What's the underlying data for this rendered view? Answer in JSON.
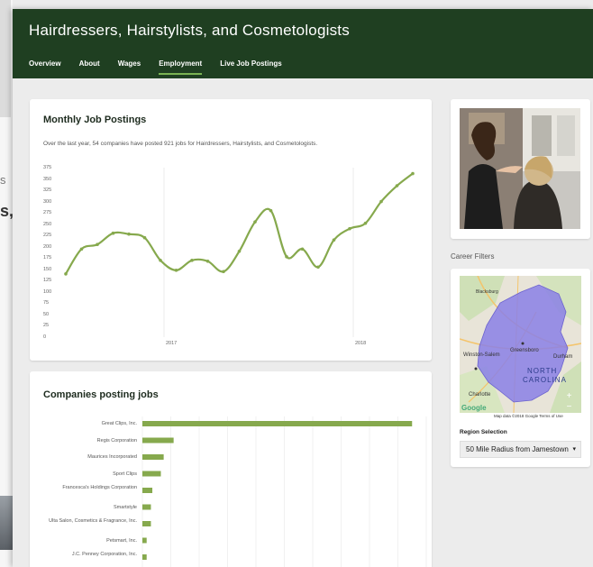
{
  "background": {
    "frag_a": "s",
    "frag_b": "s,"
  },
  "header": {
    "title": "Hairdressers, Hairstylists, and Cosmetologists",
    "tabs": [
      {
        "label": "Overview"
      },
      {
        "label": "About"
      },
      {
        "label": "Wages"
      },
      {
        "label": "Employment",
        "active": true
      },
      {
        "label": "Live Job Postings"
      }
    ]
  },
  "job_postings": {
    "title": "Monthly Job Postings",
    "subtitle": "Over the last year, 54 companies have posted 921 jobs for Hairdressers, Hairstylists, and Cosmetologists."
  },
  "companies": {
    "title": "Companies posting jobs"
  },
  "sidebar": {
    "career_filters_label": "Career Filters",
    "region_label": "Region Selection",
    "region_value": "50 Mile Radius from Jamestown",
    "map": {
      "city_1": "Blacksburg",
      "city_2": "Winston-Salem",
      "city_3": "Greensboro",
      "city_4": "Durham",
      "city_5": "Charlotte",
      "state_1": "NORTH",
      "state_2": "CAROLINA",
      "google": "Google",
      "footer": "Map data ©2018 Google   Terms of Use",
      "zoom_in": "+",
      "zoom_out": "−"
    }
  },
  "chart_data": [
    {
      "type": "line",
      "title": "Monthly Job Postings",
      "yticks": [
        "375",
        "350",
        "325",
        "300",
        "275",
        "250",
        "225",
        "200",
        "175",
        "150",
        "125",
        "100",
        "75",
        "50",
        "25",
        "0"
      ],
      "ylim": [
        0,
        375
      ],
      "xtick_labels": [
        "2017",
        "2018"
      ],
      "values": [
        140,
        195,
        205,
        230,
        228,
        220,
        170,
        148,
        170,
        168,
        145,
        190,
        255,
        280,
        178,
        195,
        155,
        215,
        240,
        252,
        300,
        335,
        362
      ],
      "color": "#86a94d"
    },
    {
      "type": "bar",
      "orientation": "horizontal",
      "title": "Companies posting jobs",
      "categories": [
        "Great Clips, Inc.",
        "Regis Corporation",
        "Maurices Incorporated",
        "Sport Clips",
        "Francesca's Holdings Corporation",
        "Smartstyle",
        "Ulta Salon, Cosmetics & Fragrance, Inc.",
        "Petsmart, Inc.",
        "J.C. Penney Corporation, Inc."
      ],
      "values": [
        190,
        22,
        15,
        13,
        7,
        6,
        6,
        3,
        3
      ],
      "xlim": [
        0,
        200
      ],
      "color": "#86a94d"
    }
  ]
}
